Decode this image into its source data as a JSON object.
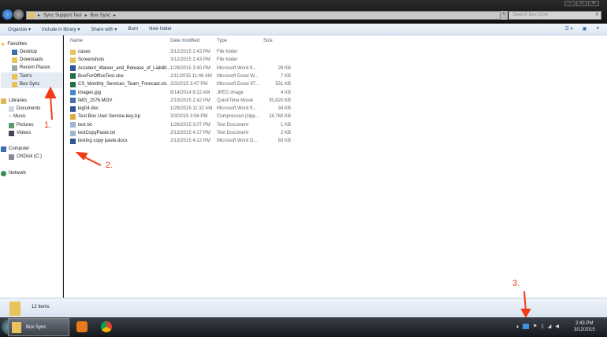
{
  "window": {
    "breadcrumb": [
      "Sync Support Test",
      "Box Sync"
    ],
    "search_placeholder": "Search Box Sync"
  },
  "toolbar": {
    "organize": "Organize ▾",
    "include": "Include in library ▾",
    "share": "Share with ▾",
    "burn": "Burn",
    "new_folder": "New folder"
  },
  "sidebar": {
    "favorites": "Favorites",
    "desktop": "Desktop",
    "downloads": "Downloads",
    "recent": "Recent Places",
    "toms": "Tom's",
    "boxsync": "Box Sync",
    "libraries": "Libraries",
    "documents": "Documents",
    "music": "Music",
    "pictures": "Pictures",
    "videos": "Videos",
    "computer": "Computer",
    "osdisk": "OSDisk (C:)",
    "network": "Network"
  },
  "columns": {
    "name": "Name",
    "date": "Date modified",
    "type": "Type",
    "size": "Size"
  },
  "files": [
    {
      "name": "cases",
      "date": "3/12/2015 2:43 PM",
      "type": "File folder",
      "size": "",
      "kind": "folder"
    },
    {
      "name": "Screenshots",
      "date": "3/12/2015 2:43 PM",
      "type": "File folder",
      "size": "",
      "kind": "folder"
    },
    {
      "name": "Accident_Waiver_and_Release_of_Liabilit...",
      "date": "1/29/2015 3:40 PM",
      "type": "Microsoft Word 9...",
      "size": "28 KB",
      "kind": "word"
    },
    {
      "name": "BoxForOfficeTest.xlsx",
      "date": "2/11/2015 11:46 AM",
      "type": "Microsoft Excel W...",
      "size": "7 KB",
      "kind": "excel"
    },
    {
      "name": "CS_Monthly_Services_Team_Forecast.xls",
      "date": "2/3/2015 3:47 PM",
      "type": "Microsoft Excel 97...",
      "size": "531 KB",
      "kind": "excel"
    },
    {
      "name": "images.jpg",
      "date": "8/14/2014 8:22 AM",
      "type": "JPEG image",
      "size": "4 KB",
      "kind": "image"
    },
    {
      "name": "IMG_1576.MOV",
      "date": "2/19/2015 2:42 PM",
      "type": "QuickTime Movie",
      "size": "35,820 KB",
      "kind": "video"
    },
    {
      "name": "leg04.doc",
      "date": "1/29/2015 11:32 AM",
      "type": "Microsoft Word 9...",
      "size": "34 KB",
      "kind": "word"
    },
    {
      "name": "Test Box User Service.key.zip",
      "date": "3/3/2015 3:56 PM",
      "type": "Compressed (zipp...",
      "size": "24,760 KB",
      "kind": "zip"
    },
    {
      "name": "test.txt",
      "date": "1/26/2015 3:07 PM",
      "type": "Text Document",
      "size": "1 KB",
      "kind": "text"
    },
    {
      "name": "testCopyPaste.txt",
      "date": "2/13/2015 4:17 PM",
      "type": "Text Document",
      "size": "2 KB",
      "kind": "text"
    },
    {
      "name": "testing copy paste.docx",
      "date": "2/13/2015 4:12 PM",
      "type": "Microsoft Word D...",
      "size": "83 KB",
      "kind": "word"
    }
  ],
  "status": {
    "count": "12 items"
  },
  "taskbar": {
    "active": "Box Sync",
    "time": "2:43 PM",
    "date": "3/12/2015"
  },
  "annotations": [
    "1.",
    "2.",
    "3."
  ],
  "colors": {
    "arrow": "#f23b12",
    "folder": "#e8c25a",
    "word": "#2b5797",
    "excel": "#1e7145"
  }
}
